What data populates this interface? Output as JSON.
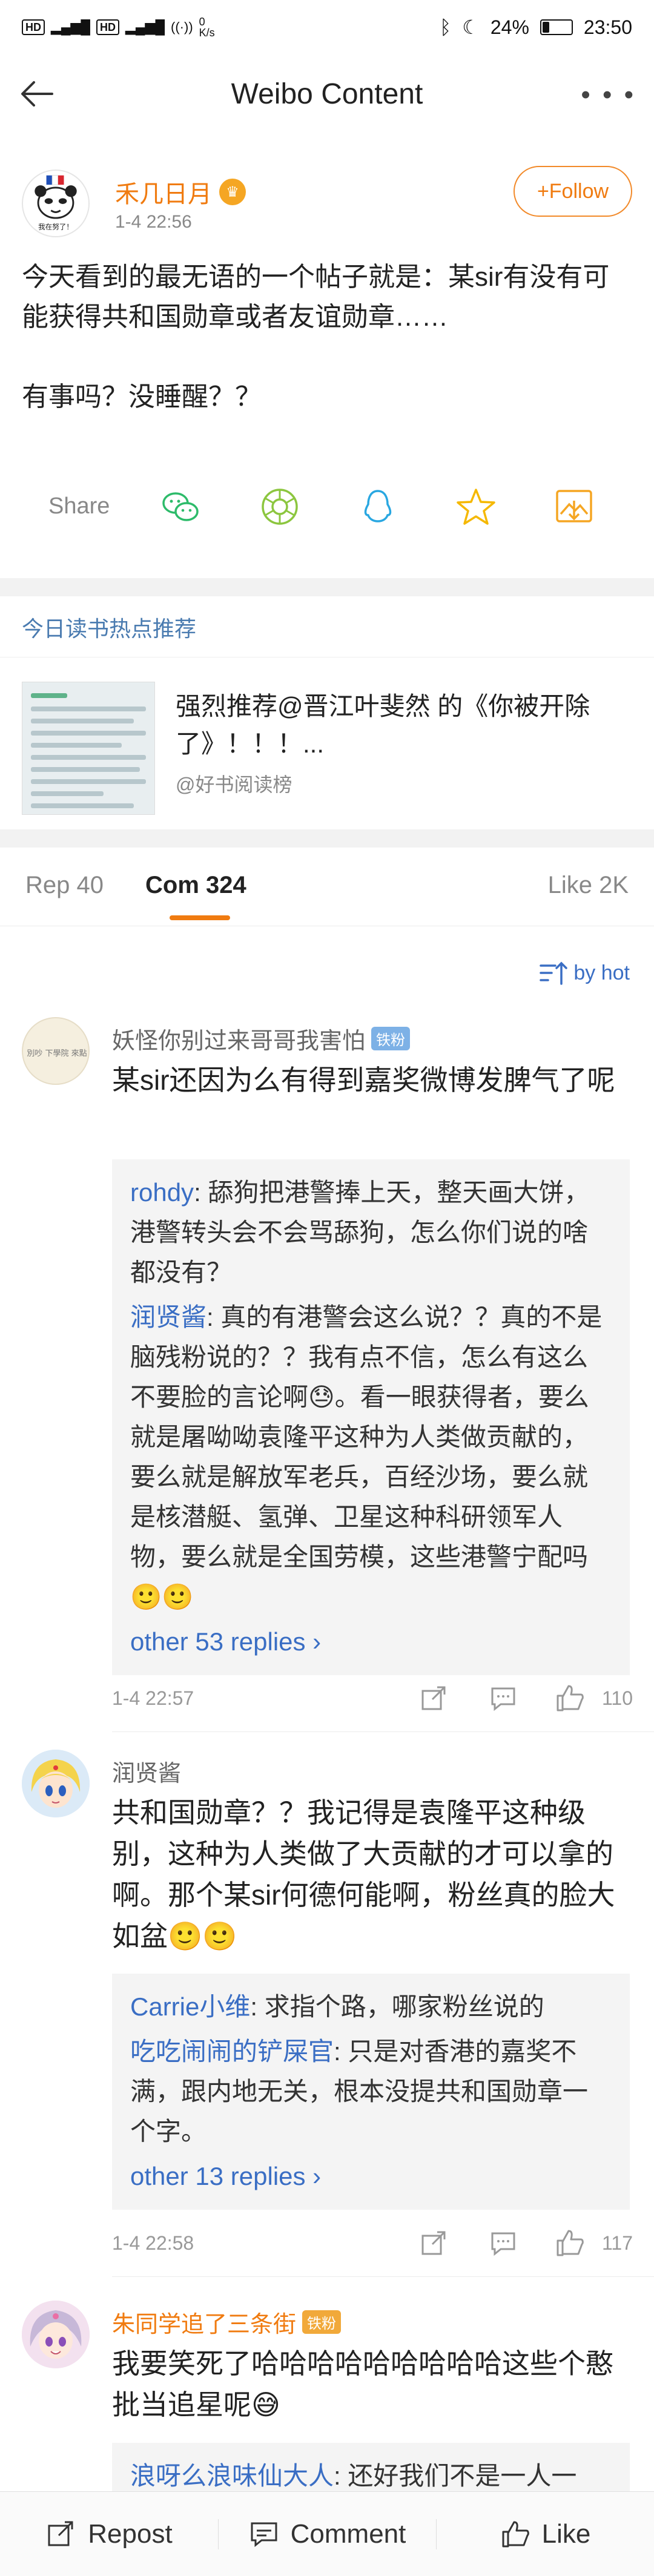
{
  "status_bar": {
    "left_tags": [
      "HD",
      "4G",
      "4G"
    ],
    "speed": "0\nK/s",
    "battery": "24%",
    "time": "23:50",
    "battery_level": 0.24
  },
  "header": {
    "title": "Weibo Content"
  },
  "post": {
    "username": "禾几日月",
    "time": "1-4 22:56",
    "follow_label": "+Follow",
    "text": "今天看到的最无语的一个帖子就是：某sir有没有可能获得共和国勋章或者友谊勋章……\n\n有事吗？没睡醒？？",
    "avatar_caption": "我在努了！",
    "share_label": "Share"
  },
  "reading": {
    "section_title": "今日读书热点推荐",
    "text": "强烈推荐@晋江叶斐然 的《你被开除了》！！！...",
    "source": "@好书阅读榜"
  },
  "tabs": [
    {
      "label": "Rep 40"
    },
    {
      "label": "Com 324"
    },
    {
      "label": "Like 2K"
    }
  ],
  "sort_label": "by hot",
  "comments": [
    {
      "name": "妖怪你别过来哥哥我害怕",
      "badge": "铁粉",
      "text": "某sir还因为么有得到嘉奖微博发脾气了呢",
      "avatar_caption": "別吵 下學院 來點",
      "replies": [
        {
          "name": "rohdy",
          "text": ": 舔狗把港警捧上天，整天画大饼，港警转头会不会骂舔狗，怎么你们说的啥都没有？"
        },
        {
          "name": "润贤酱",
          "text": ": 真的有港警会这么说？？真的不是脑残粉说的？？我有点不信，怎么有这么不要脸的言论啊😓。看一眼获得者，要么就是屠呦呦袁隆平这种为人类做贡献的，要么就是解放军老兵，百经沙场，要么就是核潜艇、氢弹、卫星这种科研领军人物，要么就是全国劳模，这些港警宁配吗🙂🙂"
        }
      ],
      "more": "other 53 replies ›",
      "time": "1-4 22:57",
      "likes": "110"
    },
    {
      "name": "润贤酱",
      "text": "共和国勋章？？我记得是袁隆平这种级别，这种为人类做了大贡献的才可以拿的啊。那个某sir何德何能啊，粉丝真的脸大如盆🙂🙂",
      "replies": [
        {
          "name": "Carrie小维",
          "text": ": 求指个路，哪家粉丝说的"
        },
        {
          "name": "吃吃闹闹的铲屎官",
          "text": ": 只是对香港的嘉奖不满，跟内地无关，根本没提共和国勋章一个字。"
        }
      ],
      "more": "other 13 replies ›",
      "time": "1-4 22:58",
      "likes": "117"
    },
    {
      "name": "朱同学追了三条街",
      "badge": "铁粉",
      "text": "我要笑死了哈哈哈哈哈哈哈哈哈这些个憨批当追星呢😅",
      "replies": [
        {
          "name": "浪呀么浪味仙大人",
          "text": ": 还好我们不是一人一"
        }
      ]
    }
  ],
  "bottom_bar": {
    "repost": "Repost",
    "comment": "Comment",
    "like": "Like"
  },
  "colors": {
    "accent_orange": "#f07b10",
    "link_blue": "#3a6ec4",
    "section_gray": "#f2f2f2"
  }
}
